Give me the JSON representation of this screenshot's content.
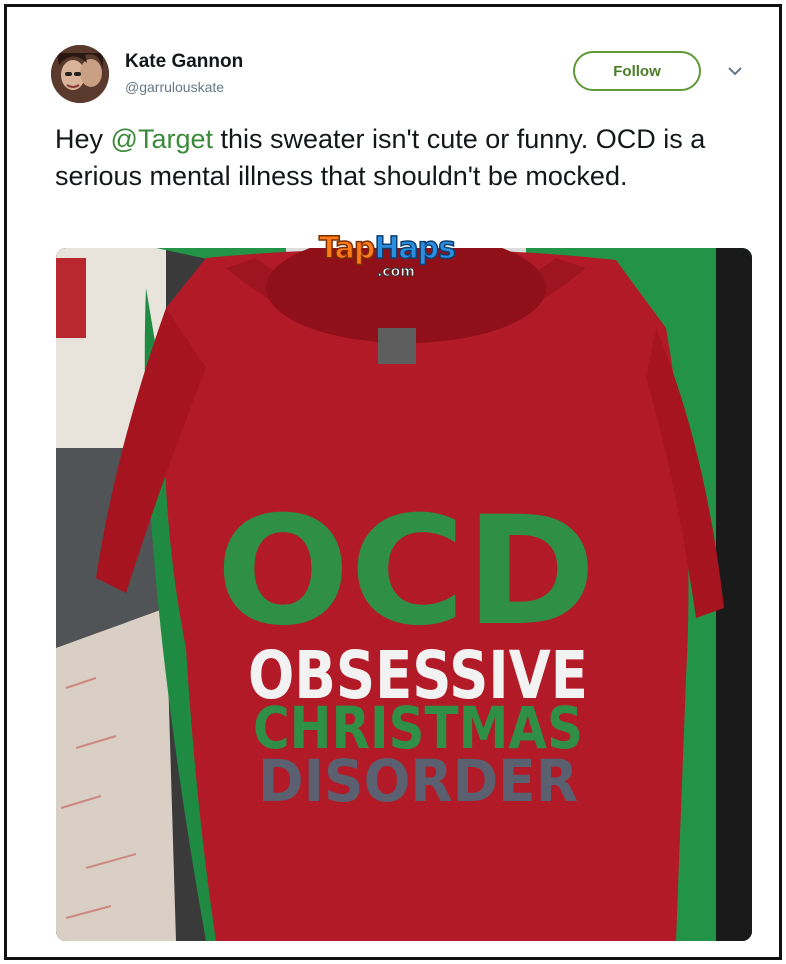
{
  "tweet": {
    "author_name": "Kate Gannon",
    "author_handle": "@garrulouskate",
    "follow_label": "Follow",
    "text_before": "Hey ",
    "mention": "@Target",
    "text_after": " this sweater isn't cute or funny. OCD is a serious mental illness that shouldn't be mocked."
  },
  "image": {
    "sweater_lines": [
      "OCD",
      "OBSESSIVE",
      "CHRISTMAS",
      "DISORDER"
    ],
    "watermark_part1": "Tap",
    "watermark_part2": "Haps",
    "watermark_sub": ".com"
  },
  "colors": {
    "follow_border": "#5f9a37",
    "mention": "#3a8a3a",
    "sweater_red": "#b31a27",
    "sweater_green_text": "#2e8f45",
    "sweater_gray_text": "#5a6070"
  },
  "icons": [
    "avatar",
    "chevron-down-icon"
  ]
}
